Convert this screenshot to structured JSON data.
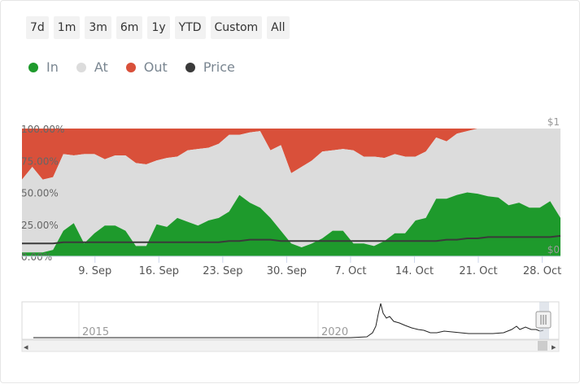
{
  "range_buttons": [
    "7d",
    "1m",
    "3m",
    "6m",
    "1y",
    "YTD",
    "Custom",
    "All"
  ],
  "legend": [
    {
      "label": "In",
      "color": "#1e9a2c"
    },
    {
      "label": "At",
      "color": "#dcdcdc"
    },
    {
      "label": "Out",
      "color": "#d9503a"
    },
    {
      "label": "Price",
      "color": "#3a3a3a"
    }
  ],
  "chart_data": {
    "type": "area",
    "stacking": "percent",
    "x_tick_labels": [
      "9. Sep",
      "16. Sep",
      "23. Sep",
      "30. Sep",
      "7. Oct",
      "14. Oct",
      "21. Oct",
      "28. Oct"
    ],
    "y_tick_labels": [
      "0.00%",
      "25.00%",
      "50.00%",
      "75.00%",
      "100.00%"
    ],
    "ylim": [
      0,
      100
    ],
    "right_axis_labels": [
      "$0",
      "$1"
    ],
    "price_ylim": [
      0,
      1
    ],
    "x_start_day": 0,
    "x_end_day": 59,
    "series": [
      {
        "name": "In",
        "color": "#1e9a2c",
        "values": [
          3,
          3,
          3,
          5,
          20,
          26,
          10,
          18,
          24,
          24,
          20,
          8,
          8,
          25,
          23,
          30,
          27,
          24,
          28,
          30,
          35,
          48,
          42,
          38,
          30,
          20,
          10,
          7,
          10,
          14,
          20,
          20,
          10,
          10,
          8,
          12,
          18,
          18,
          28,
          30,
          45,
          45,
          48,
          50,
          49,
          47,
          46,
          40,
          42,
          38,
          38,
          44,
          30
        ]
      },
      {
        "name": "At",
        "color": "#dcdcdc",
        "values": [
          57,
          67,
          57,
          57,
          60,
          53,
          70,
          62,
          52,
          55,
          59,
          65,
          64,
          50,
          54,
          48,
          56,
          60,
          57,
          58,
          60,
          47,
          55,
          60,
          53,
          67,
          55,
          63,
          65,
          68,
          63,
          64,
          73,
          68,
          70,
          65,
          62,
          60,
          50,
          52,
          48,
          45,
          48,
          48,
          51,
          53,
          54,
          60,
          58,
          62,
          62,
          58,
          70
        ]
      },
      {
        "name": "Out",
        "color": "#d9503a",
        "values": [
          40,
          30,
          40,
          38,
          20,
          21,
          20,
          20,
          24,
          21,
          21,
          27,
          28,
          25,
          23,
          22,
          17,
          16,
          15,
          12,
          5,
          5,
          3,
          2,
          17,
          13,
          35,
          30,
          25,
          18,
          17,
          16,
          17,
          22,
          22,
          23,
          20,
          22,
          22,
          18,
          7,
          10,
          4,
          2,
          0,
          0,
          0,
          0,
          0,
          0,
          0,
          0,
          0
        ]
      },
      {
        "name": "Price",
        "color": "#3a3a3a",
        "values": [
          0.1,
          0.1,
          0.1,
          0.1,
          0.11,
          0.11,
          0.11,
          0.11,
          0.11,
          0.11,
          0.11,
          0.11,
          0.11,
          0.11,
          0.11,
          0.11,
          0.11,
          0.11,
          0.11,
          0.11,
          0.12,
          0.12,
          0.13,
          0.13,
          0.13,
          0.12,
          0.12,
          0.12,
          0.12,
          0.12,
          0.12,
          0.12,
          0.12,
          0.12,
          0.12,
          0.12,
          0.12,
          0.12,
          0.12,
          0.12,
          0.12,
          0.13,
          0.13,
          0.14,
          0.14,
          0.15,
          0.15,
          0.15,
          0.15,
          0.15,
          0.15,
          0.15,
          0.16
        ]
      }
    ]
  },
  "navigator": {
    "year_labels": [
      "2015",
      "2020"
    ]
  },
  "scrollbar": {
    "left_arrow": "◂",
    "right_arrow": "▸"
  }
}
